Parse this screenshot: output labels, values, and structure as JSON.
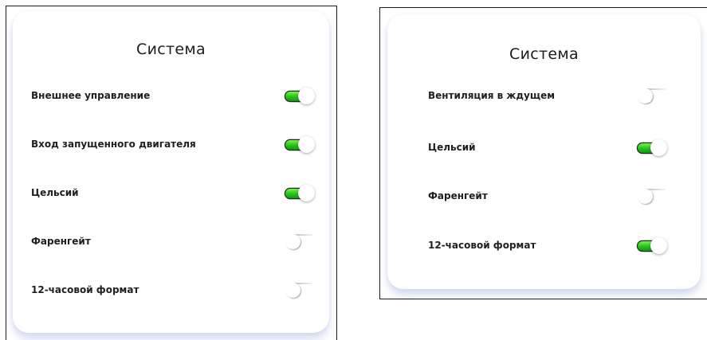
{
  "panels": [
    {
      "title": "Система",
      "settings": [
        {
          "label": "Внешнее управление",
          "enabled": true
        },
        {
          "label": "Вход запущенного двигателя",
          "enabled": true
        },
        {
          "label": "Цельсий",
          "enabled": true
        },
        {
          "label": "Фаренгейт",
          "enabled": false
        },
        {
          "label": "12-часовой формат",
          "enabled": false
        }
      ]
    },
    {
      "title": "Система",
      "settings": [
        {
          "label": "Вентиляция в ждущем",
          "enabled": false
        },
        {
          "label": "Цельсий",
          "enabled": true
        },
        {
          "label": "Фаренгейт",
          "enabled": false
        },
        {
          "label": "12-часовой формат",
          "enabled": true
        }
      ]
    }
  ],
  "colors": {
    "toggle_on": "#27c11b",
    "card_shadow": "#b8c4e8",
    "text": "#202020"
  }
}
